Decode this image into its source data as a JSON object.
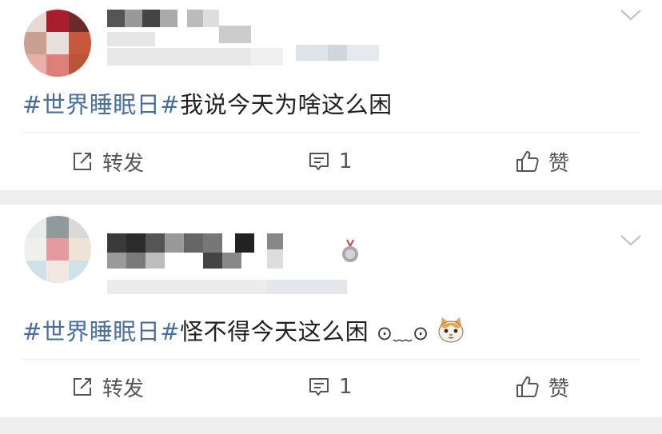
{
  "posts": [
    {
      "hashtag": "#世界睡眠日#",
      "text": "我说今天为啥这么困",
      "emojis": "",
      "actions": {
        "repost": "转发",
        "comment_count": "1",
        "like": "赞"
      }
    },
    {
      "hashtag": "#世界睡眠日#",
      "text": "怪不得今天这么困",
      "emojis": "⊙﹏⊙",
      "actions": {
        "repost": "转发",
        "comment_count": "1",
        "like": "赞"
      }
    }
  ],
  "icons": {
    "repost": "share-square-icon",
    "comment": "comment-bubble-icon",
    "like": "thumbs-up-icon",
    "more": "chevron-down-icon",
    "sticker": "cat-face-sticker"
  },
  "colors": {
    "hashtag": "#4a6f9c",
    "text": "#222222",
    "separator": "#efefef",
    "action": "#555555"
  }
}
